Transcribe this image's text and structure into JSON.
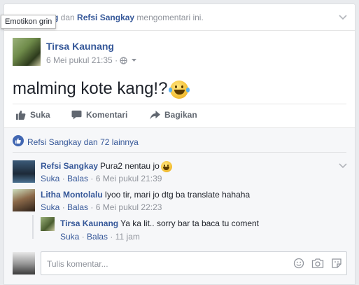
{
  "header": {
    "tooltip": "Emotikon grin",
    "name_1_partial": "g",
    "conjunction": " dan ",
    "name_2": "Refsi Sangkay",
    "suffix": " mengomentari ini."
  },
  "post": {
    "author": "Tirsa Kaunang",
    "date": "6 Mei pukul 21:35",
    "separator": " · ",
    "text": "malming kote kang!?",
    "text_emoji": "face-with-tears-of-joy"
  },
  "actions": {
    "like": "Suka",
    "comment": "Komentari",
    "share": "Bagikan"
  },
  "likes": {
    "text": "Refsi Sangkay dan 72 lainnya"
  },
  "comments": [
    {
      "name": "Refsi Sangkay",
      "text": "Pura2 nentau jo",
      "emoji": "grinning-face",
      "like": "Suka",
      "reply": "Balas",
      "time": "6 Mei pukul 21:39"
    },
    {
      "name": "Litha Montolalu",
      "text": "Iyoo tir, mari jo dtg ba translate hahaha",
      "like": "Suka",
      "reply": "Balas",
      "time": "6 Mei pukul 22:23"
    },
    {
      "name": "Tirsa Kaunang",
      "text": "Ya ka lit.. sorry bar ta baca tu coment",
      "like": "Suka",
      "reply": "Balas",
      "time": "11 jam"
    }
  ],
  "composer": {
    "placeholder": "Tulis komentar..."
  },
  "colors": {
    "link": "#365899",
    "meta": "#90949c",
    "background": "#e9ebee",
    "comments_bg": "#f6f7f9"
  }
}
